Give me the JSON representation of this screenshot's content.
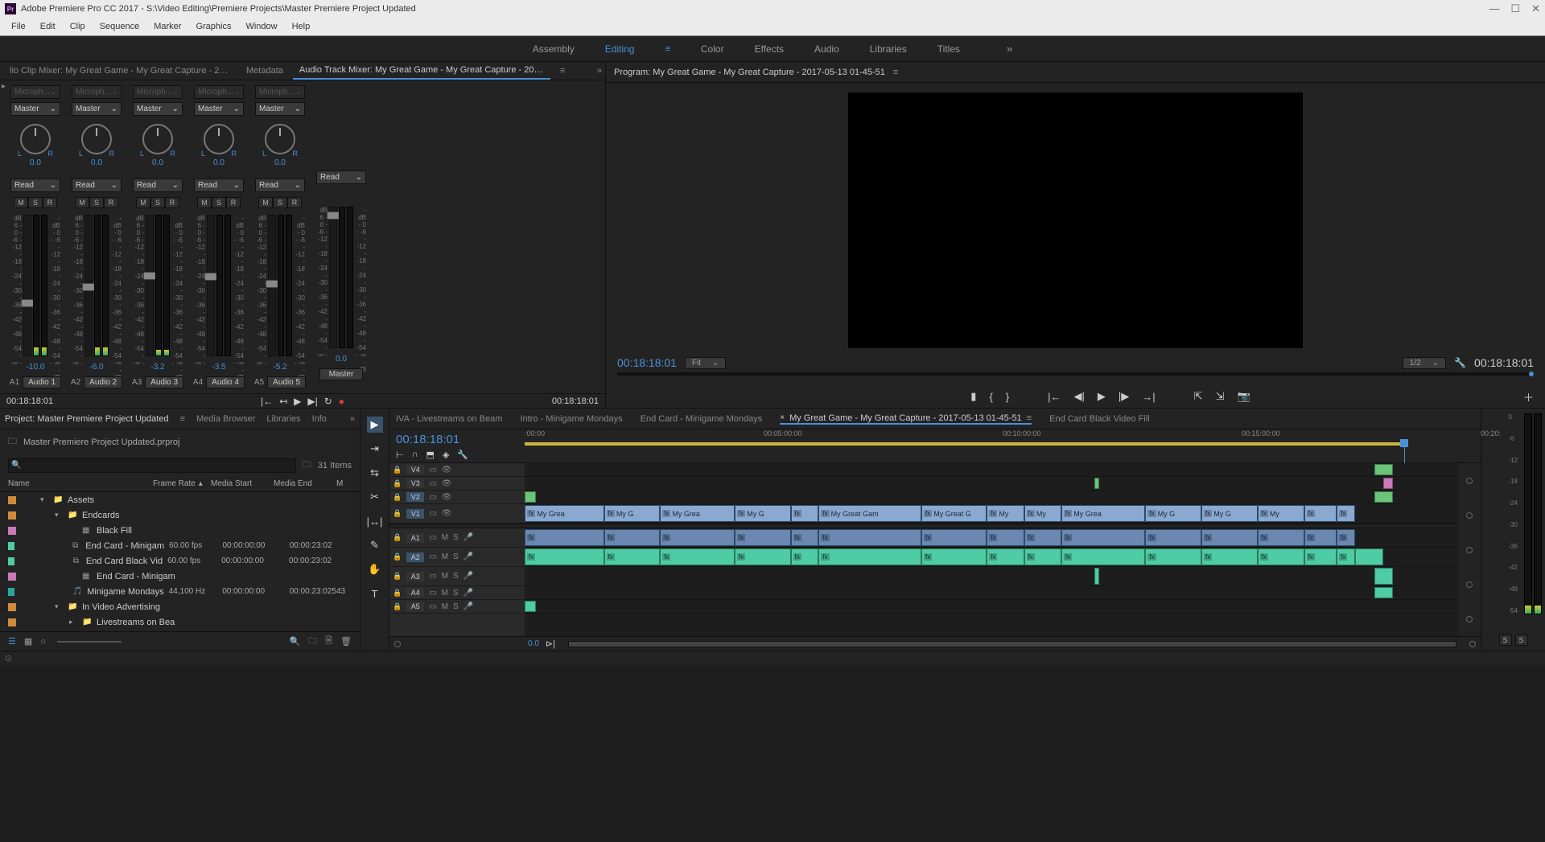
{
  "app": {
    "title": "Adobe Premiere Pro CC 2017 - S:\\Video Editing\\Premiere Projects\\Master Premiere Project Updated",
    "icon_text": "Pr"
  },
  "menu": [
    "File",
    "Edit",
    "Clip",
    "Sequence",
    "Marker",
    "Graphics",
    "Window",
    "Help"
  ],
  "workspaces": {
    "items": [
      "Assembly",
      "Editing",
      "Color",
      "Effects",
      "Audio",
      "Libraries",
      "Titles"
    ],
    "active": "Editing"
  },
  "mixer_panel": {
    "tabs": {
      "left": "lio Clip Mixer: My Great Game - My Great Capture - 2017-05-13 01-45-51",
      "meta": "Metadata",
      "active": "Audio Track Mixer: My Great Game - My Great Capture - 2017-05-13 01-45-51"
    },
    "channels": [
      {
        "input": "Microph...",
        "output": "Master",
        "pan": "0.0",
        "read": "Read",
        "gain": "-10.0",
        "id": "A1",
        "name": "Audio 1",
        "fader_top_pct": 60,
        "meter_pct": 6
      },
      {
        "input": "Microph...",
        "output": "Master",
        "pan": "0.0",
        "read": "Read",
        "gain": "-6.0",
        "id": "A2",
        "name": "Audio 2",
        "fader_top_pct": 48,
        "meter_pct": 6
      },
      {
        "input": "Microph...",
        "output": "Master",
        "pan": "0.0",
        "read": "Read",
        "gain": "-3.2",
        "id": "A3",
        "name": "Audio 3",
        "fader_top_pct": 40,
        "meter_pct": 4
      },
      {
        "input": "Microph...",
        "output": "Master",
        "pan": "0.0",
        "read": "Read",
        "gain": "-3.5",
        "id": "A4",
        "name": "Audio 4",
        "fader_top_pct": 41,
        "meter_pct": 0
      },
      {
        "input": "Microph...",
        "output": "Master",
        "pan": "0.0",
        "read": "Read",
        "gain": "-5.2",
        "id": "A5",
        "name": "Audio 5",
        "fader_top_pct": 46,
        "meter_pct": 0
      }
    ],
    "master": {
      "read": "Read",
      "gain": "0.0",
      "name": "Master",
      "fader_top_pct": 3,
      "meter_pct": 0
    },
    "scale": [
      "dB",
      "6 -",
      "0 -",
      "-6 -",
      "-12 -",
      "-18 -",
      "-24 -",
      "-30 -",
      "-36 -",
      "-42 -",
      "-48 -",
      "-54 -",
      "-∞ -"
    ],
    "scale_right": [
      "- dB",
      "- 0",
      "- -6",
      "- -12",
      "- -18",
      "- -24",
      "- -30",
      "- -36",
      "- -42",
      "- -48",
      "- -54",
      "- -∞",
      "- dB"
    ],
    "msr": {
      "m": "M",
      "s": "S",
      "r": "R"
    },
    "lr": {
      "l": "L",
      "r": "R"
    },
    "footer": {
      "tc_left": "00:18:18:01",
      "tc_right": "00:18:18:01"
    }
  },
  "program": {
    "title": "Program: My Great Game - My Great Capture - 2017-05-13 01-45-51",
    "tc_left": "00:18:18:01",
    "tc_right": "00:18:18:01",
    "fit": "Fit",
    "resolution": "1/2"
  },
  "project": {
    "tabs": [
      "Project: Master Premiere Project Updated",
      "Media Browser",
      "Libraries",
      "Info"
    ],
    "file": "Master Premiere Project Updated.prproj",
    "item_count": "31 Items",
    "columns": {
      "name": "Name",
      "frame_rate": "Frame Rate",
      "media_start": "Media Start",
      "media_end": "Media End",
      "m": "M"
    },
    "rows": [
      {
        "swatch": "sw-orange",
        "indent": 1,
        "disclosure": "▾",
        "icon": "📁",
        "name": "Assets"
      },
      {
        "swatch": "sw-orange",
        "indent": 2,
        "disclosure": "▾",
        "icon": "📁",
        "name": "Endcards"
      },
      {
        "swatch": "sw-pink",
        "indent": 3,
        "disclosure": "",
        "icon": "▦",
        "name": "Black Fill"
      },
      {
        "swatch": "sw-green",
        "indent": 3,
        "disclosure": "",
        "icon": "⧉",
        "name": "End Card - Minigam",
        "fr": "60.00 fps",
        "ms": "00:00:00:00",
        "me": "00:00:23:02"
      },
      {
        "swatch": "sw-green",
        "indent": 3,
        "disclosure": "",
        "icon": "⧉",
        "name": "End Card Black Vid",
        "fr": "60.00 fps",
        "ms": "00:00:00:00",
        "me": "00:00:23:02"
      },
      {
        "swatch": "sw-pink",
        "indent": 3,
        "disclosure": "",
        "icon": "▦",
        "name": "End Card - Minigam"
      },
      {
        "swatch": "sw-teal",
        "indent": 3,
        "disclosure": "",
        "icon": "🎵",
        "name": "Minigame Mondays",
        "fr": "44,100 Hz",
        "ms": "00:00:00:00",
        "me": "00:00:23:02543"
      },
      {
        "swatch": "sw-orange",
        "indent": 2,
        "disclosure": "▾",
        "icon": "📁",
        "name": "In Video Advertising"
      },
      {
        "swatch": "sw-orange",
        "indent": 3,
        "disclosure": "▸",
        "icon": "📁",
        "name": "Livestreams on Bea"
      }
    ]
  },
  "timeline": {
    "tabs": [
      "IVA - Livestreams on Beam",
      "Intro - Minigame Mondays",
      "End Card - Minigame Mondays",
      "My Great Game - My Great Capture - 2017-05-13 01-45-51",
      "End Card Black Video Fill"
    ],
    "active_tab_index": 3,
    "tc": "00:18:18:01",
    "ruler": [
      {
        "label": ":00:00",
        "pct": 0
      },
      {
        "label": "00:05:00:00",
        "pct": 25
      },
      {
        "label": "00:10:00:00",
        "pct": 50
      },
      {
        "label": "00:15:00:00",
        "pct": 75
      },
      {
        "label": "00:20:",
        "pct": 100
      }
    ],
    "playhead_pct": 92,
    "yellow_bar_pct": 92,
    "video_headers": [
      {
        "name": "V4",
        "selected": false,
        "tall": false
      },
      {
        "name": "V3",
        "selected": false,
        "tall": false
      },
      {
        "name": "V2",
        "selected": true,
        "tall": false
      },
      {
        "name": "V1",
        "selected": true,
        "tall": true
      }
    ],
    "audio_headers": [
      {
        "name": "A1",
        "selected": false,
        "tall": true
      },
      {
        "name": "A2",
        "selected": true,
        "tall": true
      },
      {
        "name": "A3",
        "selected": false,
        "tall": true
      },
      {
        "name": "A4",
        "selected": false,
        "tall": false
      },
      {
        "name": "A5",
        "selected": false,
        "tall": false
      }
    ],
    "track_btns": {
      "m": "M",
      "s": "S",
      "lock": "🔒",
      "mic": "🎤",
      "toggle": "▭",
      "eye": "👁"
    },
    "clip_label": "My Grea",
    "clip_label2": "My Great Gam",
    "clip_label3": "My Great G",
    "clip_label4": "My G",
    "clip_label5": "My",
    "zoom_val": "0.0"
  },
  "master_meter_scale": [
    "0",
    "-6",
    "-12",
    "-18",
    "-24",
    "-30",
    "-36",
    "-42",
    "-48",
    "-54"
  ],
  "master_meter_btns": {
    "s": "S"
  }
}
